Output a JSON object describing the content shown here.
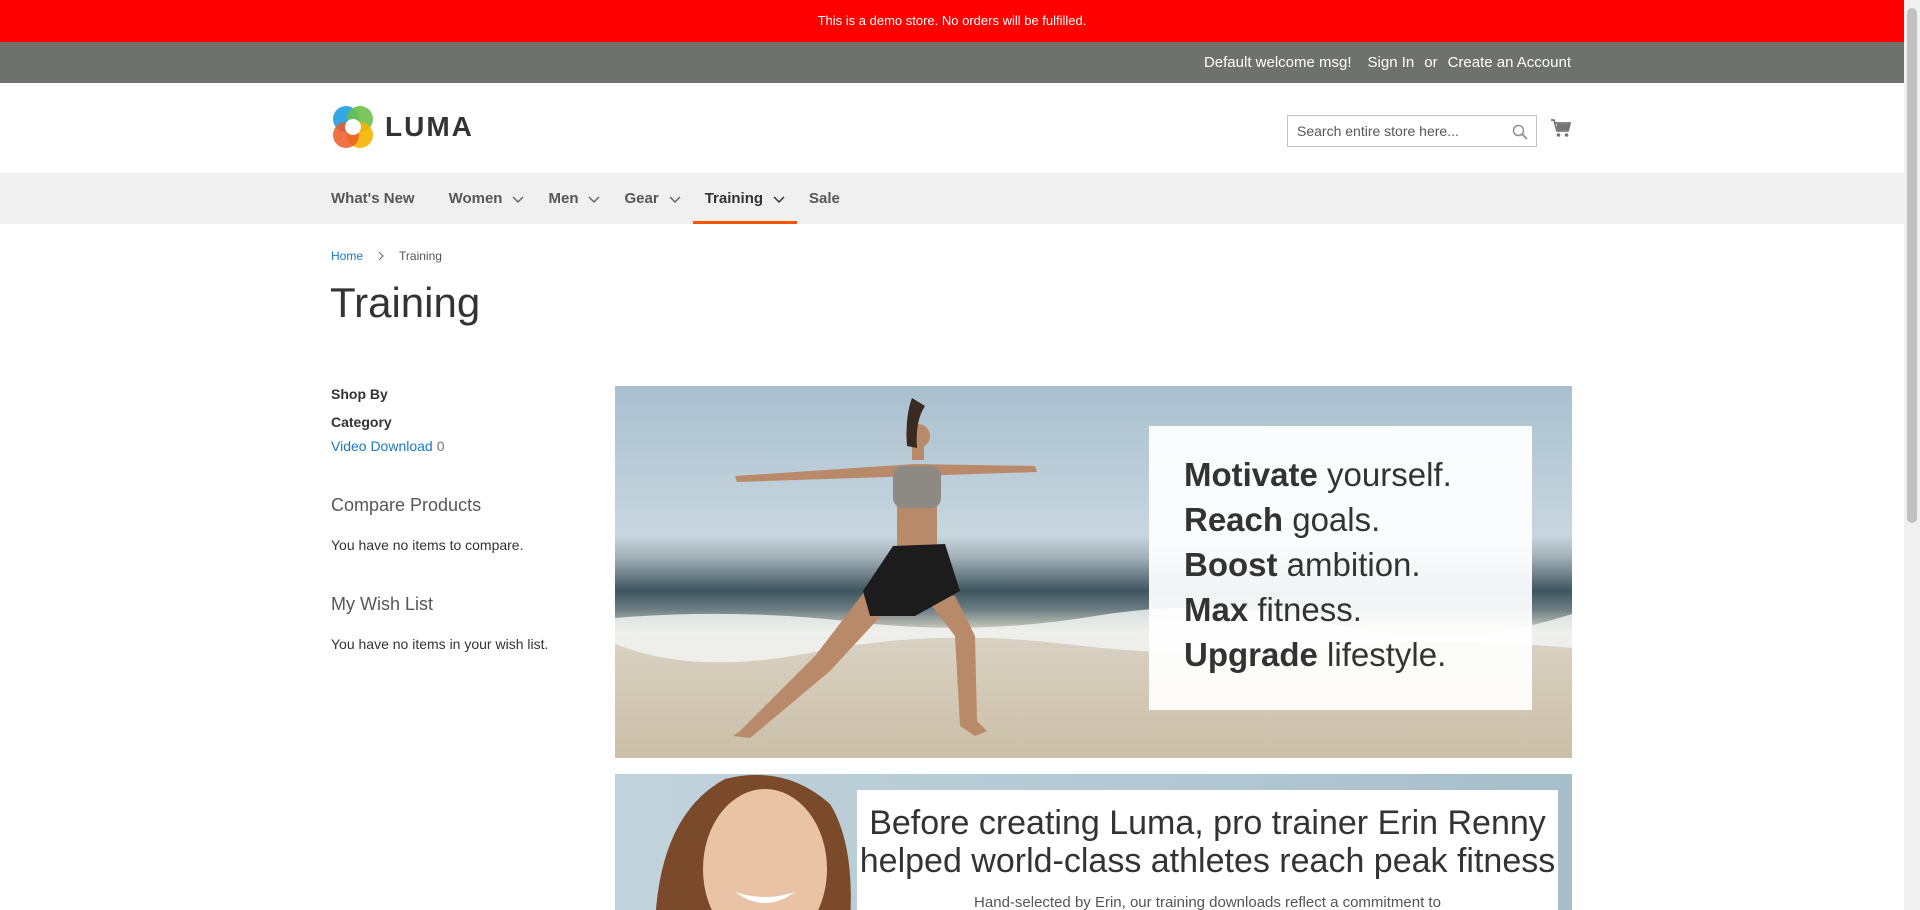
{
  "demo_notice": "This is a demo store. No orders will be fulfilled.",
  "panel": {
    "welcome": "Default welcome msg!",
    "sign_in": "Sign In",
    "or": "or",
    "create_account": "Create an Account"
  },
  "logo": {
    "text": "LUMA"
  },
  "search": {
    "placeholder": "Search entire store here..."
  },
  "nav": {
    "items": [
      {
        "label": "What's New",
        "has_dropdown": false
      },
      {
        "label": "Women",
        "has_dropdown": true
      },
      {
        "label": "Men",
        "has_dropdown": true
      },
      {
        "label": "Gear",
        "has_dropdown": true
      },
      {
        "label": "Training",
        "has_dropdown": true,
        "active": true
      },
      {
        "label": "Sale",
        "has_dropdown": false
      }
    ]
  },
  "breadcrumbs": {
    "home": "Home",
    "current": "Training"
  },
  "page_title": "Training",
  "sidebar": {
    "shop_by": "Shop By",
    "filter_title": "Category",
    "filter_item": {
      "label": "Video Download",
      "count": "0"
    },
    "compare_title": "Compare Products",
    "compare_text": "You have no items to compare.",
    "wishlist_title": "My Wish List",
    "wishlist_text": "You have no items in your wish list."
  },
  "hero": {
    "lines": [
      {
        "bold": "Motivate",
        "rest": " yourself."
      },
      {
        "bold": "Reach",
        "rest": " goals."
      },
      {
        "bold": "Boost",
        "rest": " ambition."
      },
      {
        "bold": "Max",
        "rest": " fitness."
      },
      {
        "bold": "Upgrade",
        "rest": " lifestyle."
      }
    ]
  },
  "promo": {
    "headline_1": "Before creating Luma, pro trainer Erin Renny",
    "headline_2": "helped world-class athletes reach peak fitness",
    "sub": "Hand-selected by Erin, our training downloads reflect a commitment to"
  },
  "colors": {
    "demo_bar": "#ff0000",
    "panel": "#6e716e",
    "link": "#1979c3",
    "active_underline": "#ff5501",
    "nav_bg": "#f0f0f0"
  }
}
